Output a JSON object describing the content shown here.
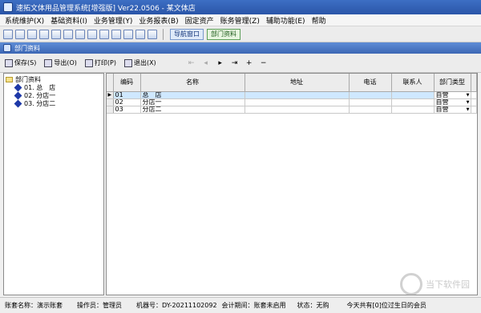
{
  "window": {
    "title": "速拓文体用品管理系统[增强版] Ver22.0506  -  某文体店"
  },
  "menu": [
    "系统维护(X)",
    "基础资料(I)",
    "业务管理(Y)",
    "业务报表(B)",
    "固定资产",
    "账务管理(Z)",
    "辅助功能(E)",
    "帮助"
  ],
  "toolbar": {
    "nav_label": "导航窗口",
    "dept_label": "部门资料"
  },
  "doc": {
    "title": "部门资料",
    "buttons": {
      "save": "保存(S)",
      "export": "导出(O)",
      "print": "打印(P)",
      "exit": "退出(X)"
    }
  },
  "tree": {
    "root": "部门资料",
    "items": [
      "01. 总　店",
      "02. 分店一",
      "03. 分店二"
    ]
  },
  "grid": {
    "headers": [
      "编码",
      "名称",
      "地址",
      "电话",
      "联系人",
      "部门类型"
    ],
    "rows": [
      [
        "01",
        "总　店",
        "",
        "",
        "",
        "自营"
      ],
      [
        "02",
        "分店一",
        "",
        "",
        "",
        "自营"
      ],
      [
        "03",
        "分店二",
        "",
        "",
        "",
        "自营"
      ]
    ]
  },
  "status": {
    "account": "账套名称：演示账套",
    "operator": "操作员：管理员",
    "machine": "机器号：DY-20211102092",
    "period": "会计期间：账套未启用",
    "state": "状态：无购",
    "birthday": "今天共有[0]位过生日的会员"
  },
  "watermark": "当下软件园"
}
